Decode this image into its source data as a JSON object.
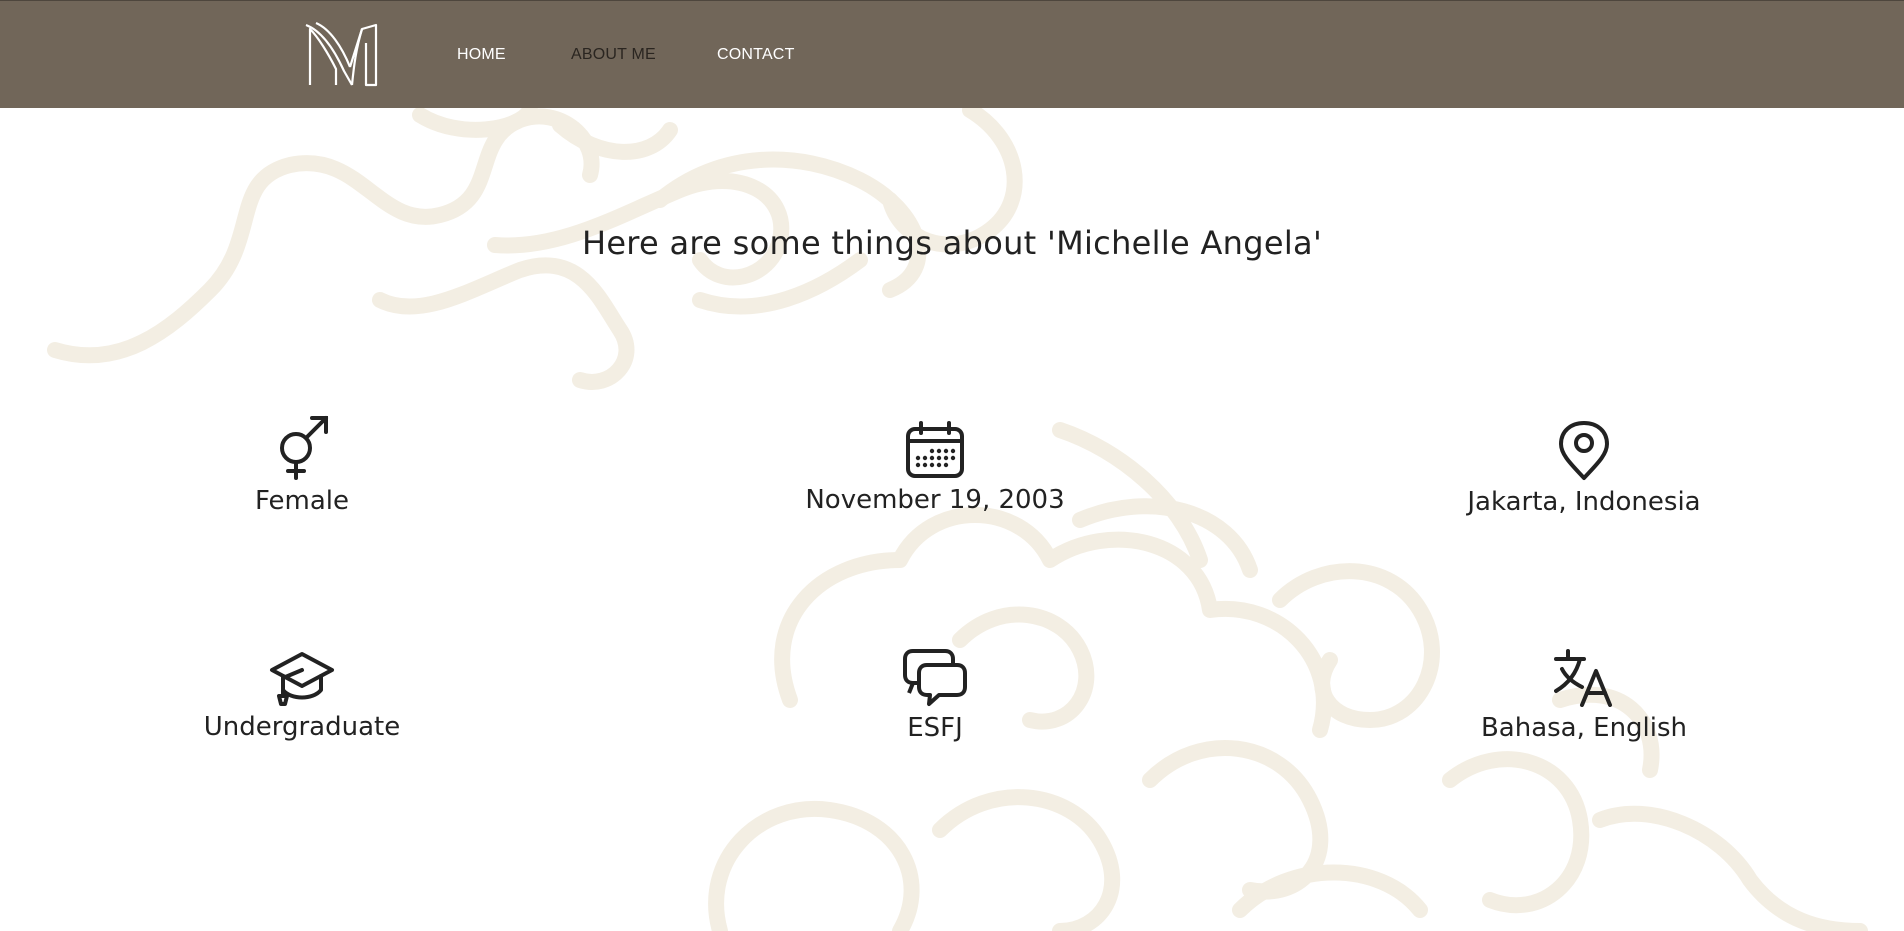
{
  "nav": {
    "logo_name": "m-logo-icon",
    "links": [
      {
        "label": "HOME",
        "active": false
      },
      {
        "label": "ABOUT ME",
        "active": true
      },
      {
        "label": "CONTACT",
        "active": false
      }
    ]
  },
  "main": {
    "title": "Here are some things about 'Michelle Angela'",
    "facts": [
      {
        "icon": "gender-icon",
        "label": "Female"
      },
      {
        "icon": "calendar-icon",
        "label": "November 19, 2003"
      },
      {
        "icon": "location-pin-icon",
        "label": "Jakarta, Indonesia"
      },
      {
        "icon": "graduation-cap-icon",
        "label": "Undergraduate"
      },
      {
        "icon": "chat-bubbles-icon",
        "label": "ESFJ"
      },
      {
        "icon": "translate-icon",
        "label": "Bahasa, English"
      }
    ]
  },
  "colors": {
    "navbar": "#716659",
    "nav_text": "#ffffff",
    "nav_active_text": "#2a2520",
    "background_swirl": "#f4efe4",
    "text": "#222222"
  }
}
